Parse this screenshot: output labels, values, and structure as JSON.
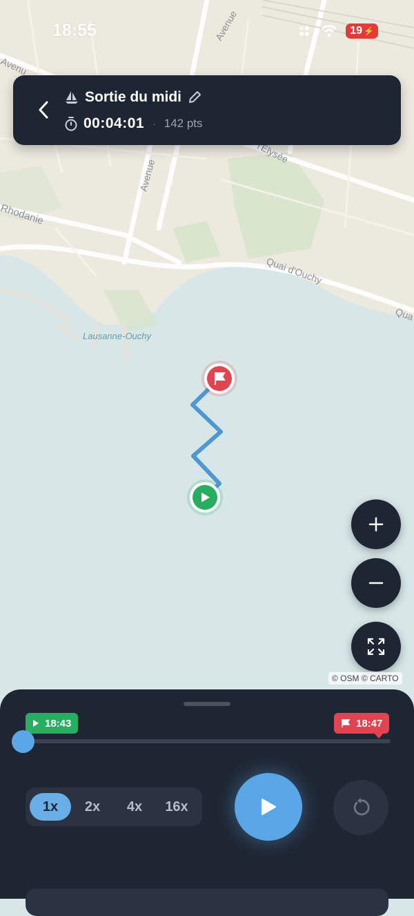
{
  "status_bar": {
    "time": "18:55",
    "battery_level": "19"
  },
  "header": {
    "title": "Sortie du midi",
    "duration": "00:04:01",
    "separator": "·",
    "points": "142 pts"
  },
  "map": {
    "labels": {
      "avenue_top": "Avenue",
      "avenue_mid": "Avenue",
      "avenue_left": "Avenu",
      "elysee": "l'Elysée",
      "rhodanie": "Rhodanie",
      "quai": "Quai d'Ouchy",
      "quai_right": "Qua",
      "port": "Lausanne-Ouchy"
    },
    "attribution": "© OSM © CARTO",
    "route_color": "#4f97d1",
    "start_color": "#27ae60",
    "end_color": "#e04450"
  },
  "playback": {
    "start_time": "18:43",
    "end_time": "18:47",
    "progress": 0,
    "speeds": [
      "1x",
      "2x",
      "4x",
      "16x"
    ],
    "selected_speed": "1x"
  },
  "icons": {
    "back": "chevron-left-icon",
    "boat": "sailboat-icon",
    "edit": "pencil-icon",
    "timer": "stopwatch-icon",
    "zoom_in": "plus-icon",
    "zoom_out": "minus-icon",
    "fit": "expand-icon",
    "play": "play-icon",
    "replay": "replay-icon",
    "start_flag": "play-icon",
    "end_flag": "flag-icon"
  }
}
